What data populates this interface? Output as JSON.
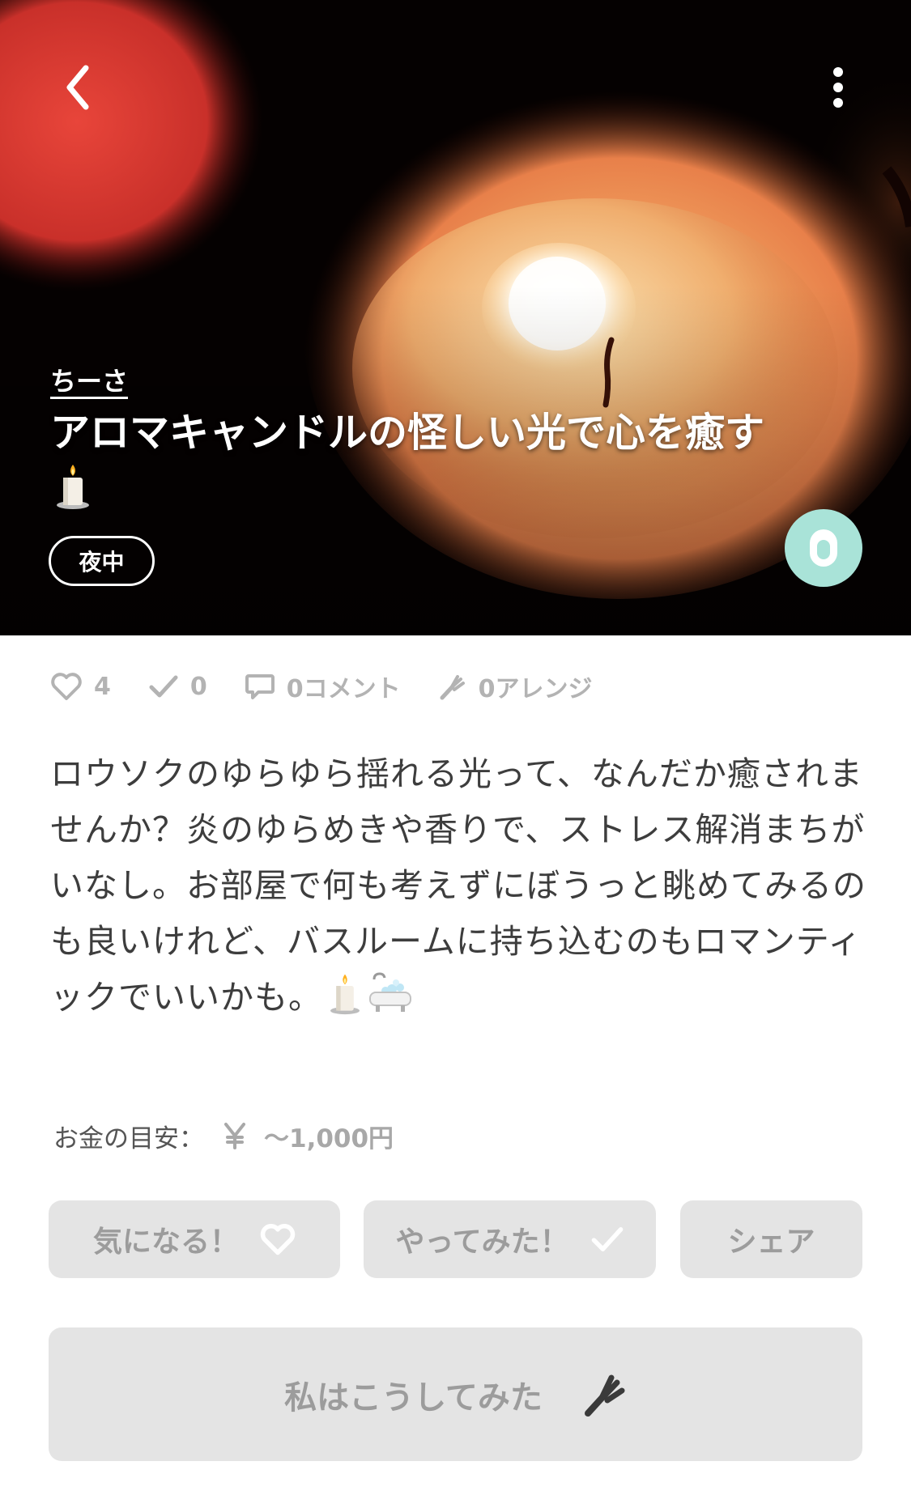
{
  "post": {
    "author": "ちーさ",
    "title": "アロマキャンドルの怪しい光で心を癒す",
    "tag": "夜中"
  },
  "stats": {
    "likes": "4",
    "done": "0",
    "comments": "0コメント",
    "arranges": "0アレンジ"
  },
  "description": "ロウソクのゆらゆら揺れる光って、なんだか癒されませんか？炎のゆらめきや香りで、ストレス解消まちがいなし。お部屋で何も考えずにぼうっと眺めてみるのも良いけれど、バスルームに持ち込むのもロマンティックでいいかも。",
  "price": {
    "label": "お金の目安：",
    "value": "〜1,000円"
  },
  "actions": {
    "interest_label": "気になる！",
    "tried_label": "やってみた！",
    "share_label": "シェア",
    "arrange_label": "私はこうしてみた"
  },
  "icons": {
    "back": "chevron-left-icon",
    "menu": "more-vertical-icon",
    "fab": "bookmark-tag-icon",
    "like": "heart-icon",
    "done": "check-icon",
    "comment": "comment-icon",
    "arrange": "fork-icon",
    "price": "yen-icon"
  },
  "colors": {
    "fab_background": "#a9e3d8",
    "button_background": "#e4e4e4",
    "muted_text": "#9c9c9c"
  }
}
